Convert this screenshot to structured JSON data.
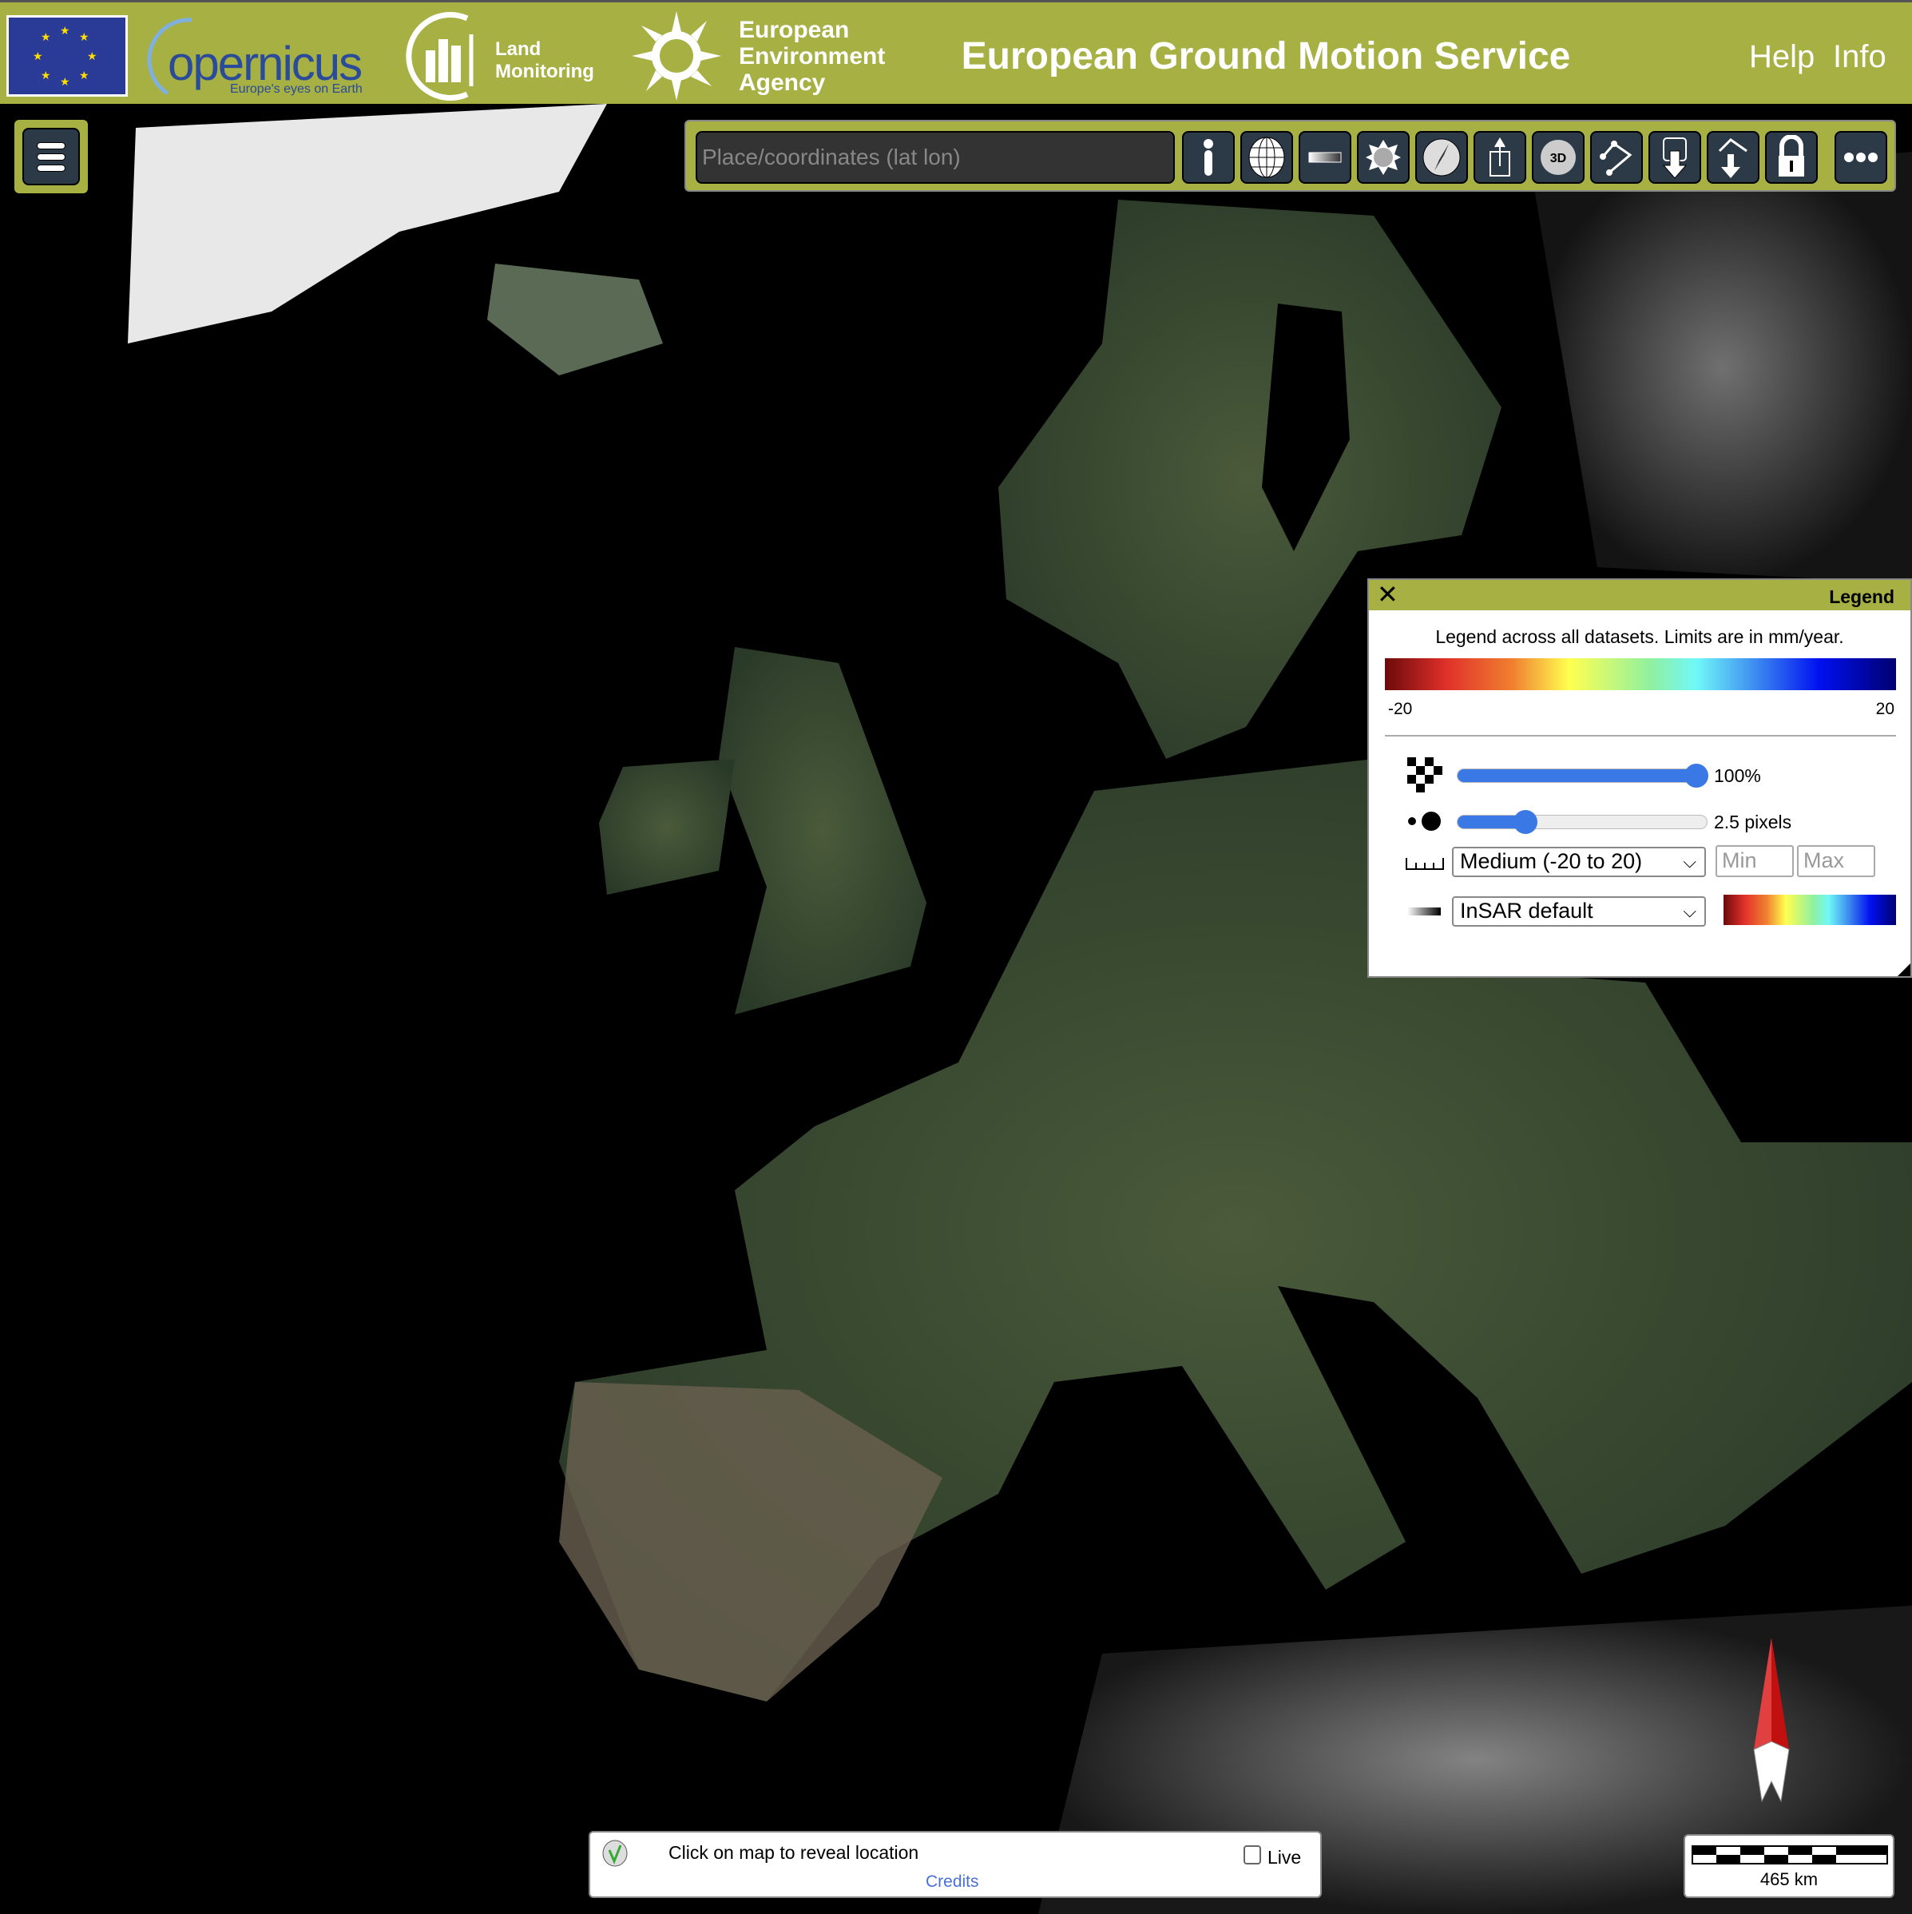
{
  "header": {
    "logos": {
      "eu": "EU flag",
      "copernicus": "opernicus",
      "copernicus_tagline": "Europe's eyes on Earth",
      "land": [
        "Land",
        "Monitoring"
      ],
      "eea": [
        "European",
        "Environment",
        "Agency"
      ]
    },
    "title": "European Ground Motion Service",
    "links": [
      {
        "label": "Help"
      },
      {
        "label": "Info"
      }
    ],
    "accent": "#a6b043"
  },
  "toolbar": {
    "search_placeholder": "Place/coordinates (lat lon)",
    "buttons": [
      {
        "icon": "info-icon"
      },
      {
        "icon": "globe-icon"
      },
      {
        "icon": "gradient-bar-icon"
      },
      {
        "icon": "sun-icon"
      },
      {
        "icon": "compass-icon"
      },
      {
        "icon": "upload-icon"
      },
      {
        "icon": "3d-icon",
        "label": "3D"
      },
      {
        "icon": "measure-path-icon"
      },
      {
        "icon": "database-download-icon"
      },
      {
        "icon": "path-download-icon"
      },
      {
        "icon": "lock-icon"
      },
      {
        "icon": "more-icon"
      }
    ]
  },
  "legend": {
    "title": "Legend",
    "note": "Legend across all datasets. Limits are in mm/year.",
    "min_label": "-20",
    "max_label": "20",
    "opacity": {
      "value": 100,
      "label": "100%"
    },
    "point_size": {
      "value": 2.5,
      "label": "2.5 pixels"
    },
    "range_select": "Medium (-20 to 20)",
    "min_placeholder": "Min",
    "max_placeholder": "Max",
    "colormap_select": "InSAR default"
  },
  "status": {
    "text": "Click on map to reveal location",
    "live_label": "Live",
    "live_checked": false,
    "credits": "Credits"
  },
  "scale": {
    "label": "465 km"
  }
}
